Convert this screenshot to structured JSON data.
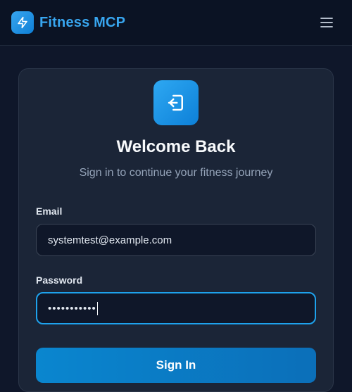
{
  "header": {
    "app_name": "Fitness MCP",
    "brand_icon": "lightning-bolt-icon",
    "menu_icon": "hamburger-menu-icon"
  },
  "login": {
    "icon": "sign-in-icon",
    "title": "Welcome Back",
    "subtitle": "Sign in to continue your fitness journey",
    "email_label": "Email",
    "email_value": "systemtest@example.com",
    "password_label": "Password",
    "password_value": "•••••••••••",
    "submit_label": "Sign In"
  },
  "colors": {
    "accent": "#38a6f0",
    "background": "#0f172a",
    "card": "#1b2537"
  }
}
